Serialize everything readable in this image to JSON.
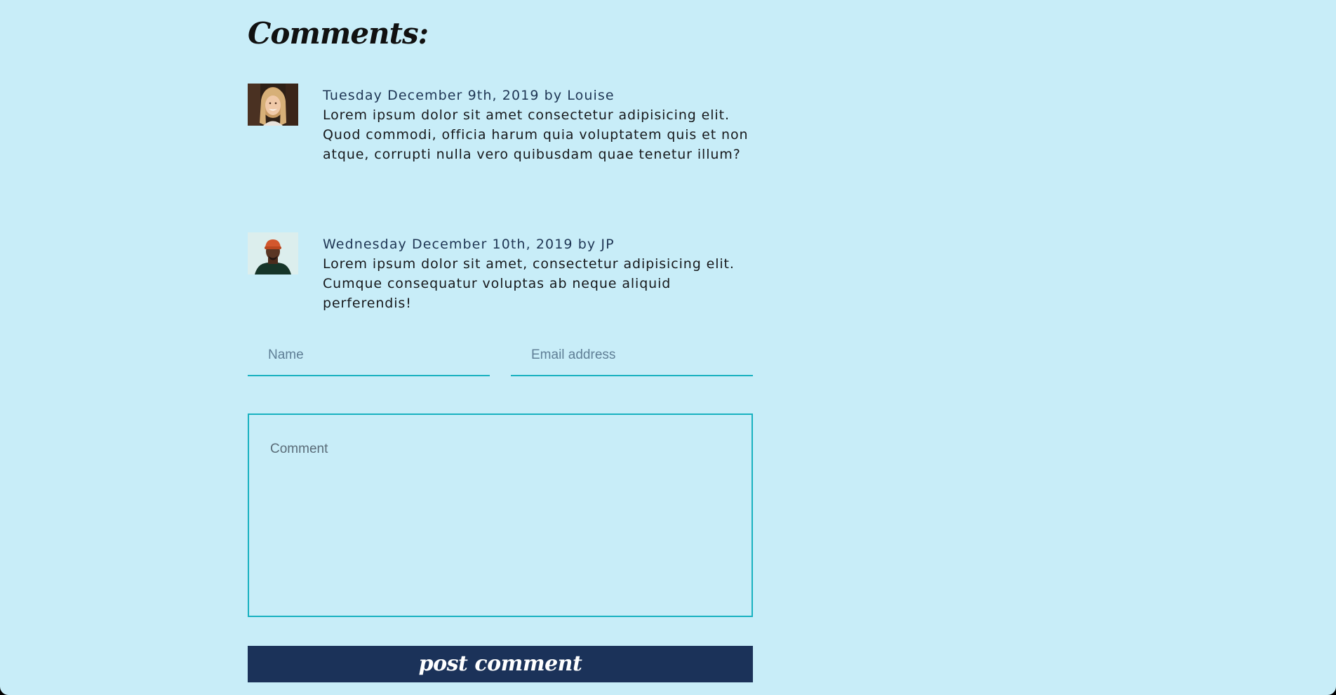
{
  "page": {
    "background_color": "#c8edf8"
  },
  "comments_section": {
    "title": "Comments:",
    "comments": [
      {
        "meta": "Tuesday December 9th, 2019 by Louise",
        "body": "Lorem ipsum dolor sit amet consectetur adipisicing elit. Quod commodi, officia harum quia voluptatem quis et non atque, corrupti nulla vero quibusdam quae tenetur illum?",
        "avatar": "woman-portrait-photo"
      },
      {
        "meta": "Wednesday December 10th, 2019 by JP",
        "body": "Lorem ipsum dolor sit amet, consectetur adipisicing elit. Cumque consequatur voluptas ab neque aliquid perferendis!",
        "avatar": "man-orange-beanie-photo"
      }
    ]
  },
  "form": {
    "name_placeholder": "Name",
    "email_placeholder": "Email address",
    "comment_placeholder": "Comment",
    "submit_label": "post comment",
    "accent_color": "#18b1c0",
    "button_color": "#1b3259"
  }
}
